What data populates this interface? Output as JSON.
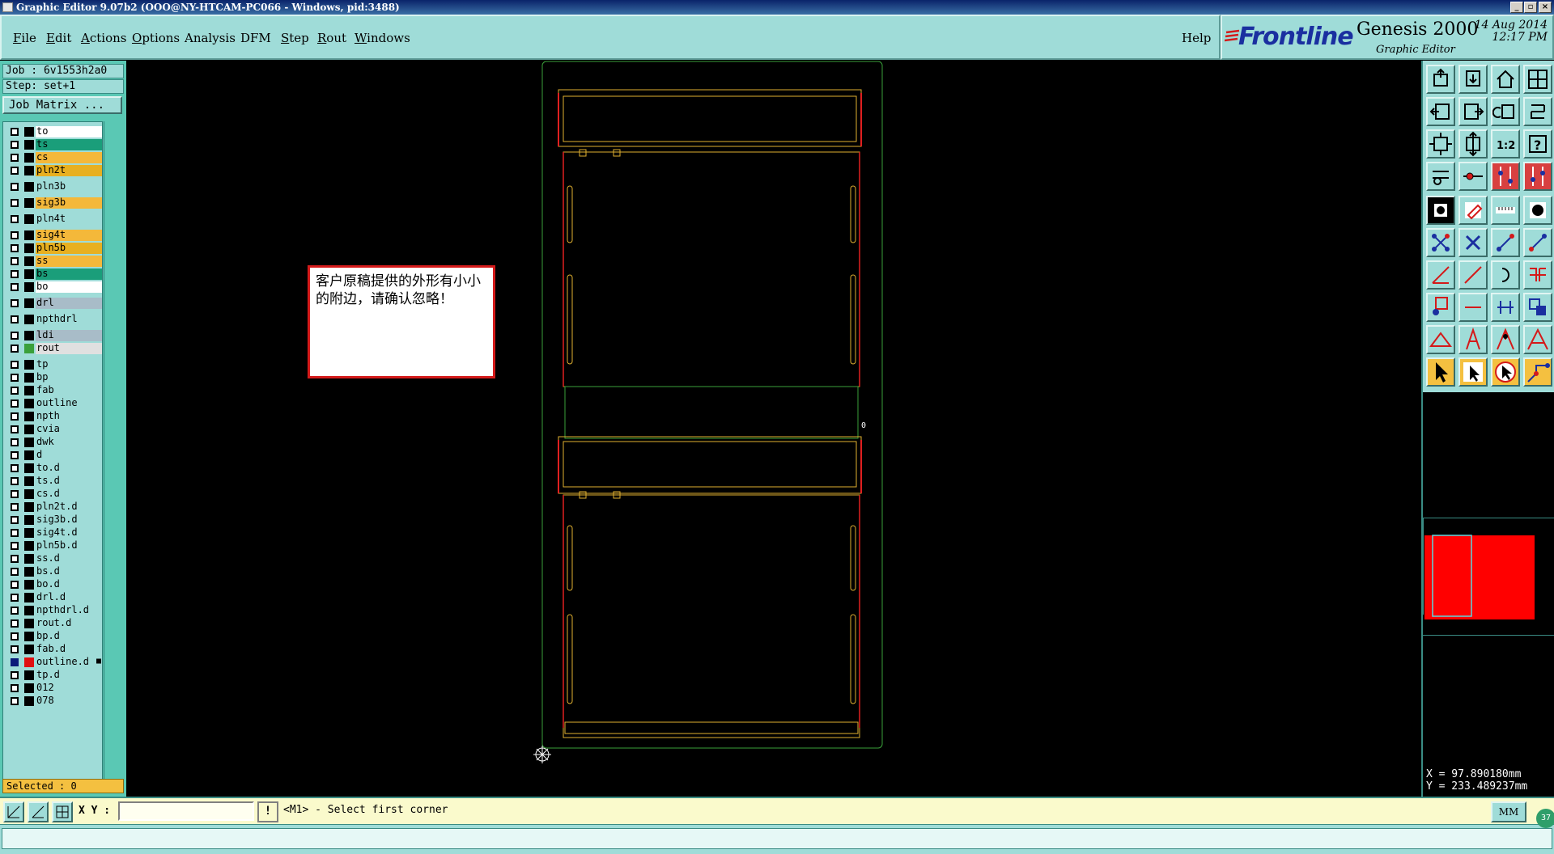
{
  "window": {
    "title": "Graphic Editor 9.07b2 (OOO@NY-HTCAM-PC066 - Windows, pid:3488)"
  },
  "menu": [
    {
      "label": "File",
      "u": "F",
      "rest": "ile"
    },
    {
      "label": "Edit",
      "u": "E",
      "rest": "dit"
    },
    {
      "label": "Actions",
      "u": "A",
      "rest": "ctions"
    },
    {
      "label": "Options",
      "u": "O",
      "rest": "ptions"
    },
    {
      "label": "Analysis",
      "u": "",
      "rest": "Analysis"
    },
    {
      "label": "DFM",
      "u": "",
      "rest": "DFM"
    },
    {
      "label": "Step",
      "u": "S",
      "rest": "tep"
    },
    {
      "label": "Rout",
      "u": "R",
      "rest": "out"
    },
    {
      "label": "Windows",
      "u": "W",
      "rest": "indows"
    }
  ],
  "help_label": "Help",
  "brand": {
    "company": "Frontline",
    "product": "Genesis 2000",
    "subtitle": "Graphic Editor",
    "date": "14 Aug 2014",
    "time": "12:17 PM"
  },
  "job": {
    "job_label": "Job : 6v1553h2a0",
    "step_label": "Step: set+1",
    "matrix_button": "Job Matrix ..."
  },
  "layers": [
    {
      "name": "to",
      "color": "#ffffff",
      "box": "#000000"
    },
    {
      "name": "ts",
      "color": "#1a9e7a",
      "box": "#000000"
    },
    {
      "name": "cs",
      "color": "#f4b83a",
      "box": "#000000"
    },
    {
      "name": "pln2t",
      "color": "#e8b020",
      "box": "#000000"
    },
    {
      "name": "pln3b",
      "color": "#9fdcd8",
      "box": "#000000",
      "gap": 4
    },
    {
      "name": "sig3b",
      "color": "#f4b83a",
      "box": "#000000",
      "gap": 4
    },
    {
      "name": "pln4t",
      "color": "#9fdcd8",
      "box": "#000000",
      "gap": 4
    },
    {
      "name": "sig4t",
      "color": "#f4b83a",
      "box": "#000000",
      "gap": 4
    },
    {
      "name": "pln5b",
      "color": "#e8b020",
      "box": "#000000"
    },
    {
      "name": "ss",
      "color": "#f4b83a",
      "box": "#000000"
    },
    {
      "name": "bs",
      "color": "#1a9e7a",
      "box": "#000000"
    },
    {
      "name": "bo",
      "color": "#ffffff",
      "box": "#000000"
    },
    {
      "name": "drl",
      "color": "#a8bcc8",
      "box": "#000000",
      "gap": 4
    },
    {
      "name": "npthdrl",
      "color": "#9fdcd8",
      "box": "#000000",
      "gap": 4
    },
    {
      "name": "ldi",
      "color": "#a8bcc8",
      "box": "#000000",
      "gap": 4
    },
    {
      "name": "rout",
      "color": "#e0e0e0",
      "box": "#3aa03a"
    },
    {
      "name": "tp",
      "color": "#9fdcd8",
      "box": "#000000",
      "gap": 4
    },
    {
      "name": "bp",
      "color": "#9fdcd8",
      "box": "#000000"
    },
    {
      "name": "fab",
      "color": "#9fdcd8",
      "box": "#000000"
    },
    {
      "name": "outline",
      "color": "#9fdcd8",
      "box": "#000000"
    },
    {
      "name": "npth",
      "color": "#9fdcd8",
      "box": "#000000"
    },
    {
      "name": "cvia",
      "color": "#9fdcd8",
      "box": "#000000"
    },
    {
      "name": "dwk",
      "color": "#9fdcd8",
      "box": "#000000"
    },
    {
      "name": "d",
      "color": "#9fdcd8",
      "box": "#000000"
    },
    {
      "name": "to.d",
      "color": "#9fdcd8",
      "box": "#000000"
    },
    {
      "name": "ts.d",
      "color": "#9fdcd8",
      "box": "#000000"
    },
    {
      "name": "cs.d",
      "color": "#9fdcd8",
      "box": "#000000"
    },
    {
      "name": "pln2t.d",
      "color": "#9fdcd8",
      "box": "#000000"
    },
    {
      "name": "sig3b.d",
      "color": "#9fdcd8",
      "box": "#000000"
    },
    {
      "name": "sig4t.d",
      "color": "#9fdcd8",
      "box": "#000000"
    },
    {
      "name": "pln5b.d",
      "color": "#9fdcd8",
      "box": "#000000"
    },
    {
      "name": "ss.d",
      "color": "#9fdcd8",
      "box": "#000000"
    },
    {
      "name": "bs.d",
      "color": "#9fdcd8",
      "box": "#000000"
    },
    {
      "name": "bo.d",
      "color": "#9fdcd8",
      "box": "#000000"
    },
    {
      "name": "drl.d",
      "color": "#9fdcd8",
      "box": "#000000"
    },
    {
      "name": "npthdrl.d",
      "color": "#9fdcd8",
      "box": "#000000"
    },
    {
      "name": "rout.d",
      "color": "#9fdcd8",
      "box": "#000000"
    },
    {
      "name": "bp.d",
      "color": "#9fdcd8",
      "box": "#000000"
    },
    {
      "name": "fab.d",
      "color": "#9fdcd8",
      "box": "#000000"
    },
    {
      "name": "outline.d",
      "color": "#9fdcd8",
      "box": "#e01010",
      "selected": true,
      "suffix": "■"
    },
    {
      "name": "tp.d",
      "color": "#9fdcd8",
      "box": "#000000"
    },
    {
      "name": "012",
      "color": "#9fdcd8",
      "box": "#000000"
    },
    {
      "name": "078",
      "color": "#9fdcd8",
      "box": "#000000"
    }
  ],
  "selected_label": "Selected : 0",
  "note": {
    "text": "客户原稿提供的外形有小小的附边，请确认忽略！"
  },
  "coords": {
    "x": "X = 97.890180mm",
    "y": "Y = 233.489237mm"
  },
  "bottom": {
    "xy_label": "X Y :",
    "xy_value": "",
    "warn": "!",
    "prompt": "<M1> - Select first corner",
    "units": "MM",
    "badge": "37"
  },
  "colors": {
    "profile": "#3aa03a",
    "outline_red": "#e02020",
    "rout_yellow": "#e0b030",
    "panel": "#9fdcd8",
    "accent": "#5ac8b4"
  },
  "icons": [
    "zoom-home-icon",
    "zoom-in-window-icon",
    "house-icon",
    "grid-view-icon",
    "pan-left-icon",
    "pan-right-icon",
    "undo-view-icon",
    "redo-view-icon",
    "fit-all-icon",
    "fit-profile-icon",
    "ratio-1-2-icon",
    "query-icon",
    "snap-icon",
    "measure-icon",
    "layers-red-icon",
    "layers-red2-icon",
    "pad-icon",
    "polygon-icon",
    "ruler-icon",
    "dot-icon",
    "net-icon",
    "cross-icon",
    "connect-icon",
    "connect2-icon",
    "line-icon",
    "line2-icon",
    "arc-icon",
    "split-icon",
    "move-icon",
    "minus-icon",
    "stretch-icon",
    "copy-icon",
    "triangle-icon",
    "triangle2-icon",
    "triangle3-icon",
    "triangle4-icon",
    "pointer-icon",
    "pointer-select-icon",
    "pointer-rotate-icon",
    "route-icon"
  ]
}
